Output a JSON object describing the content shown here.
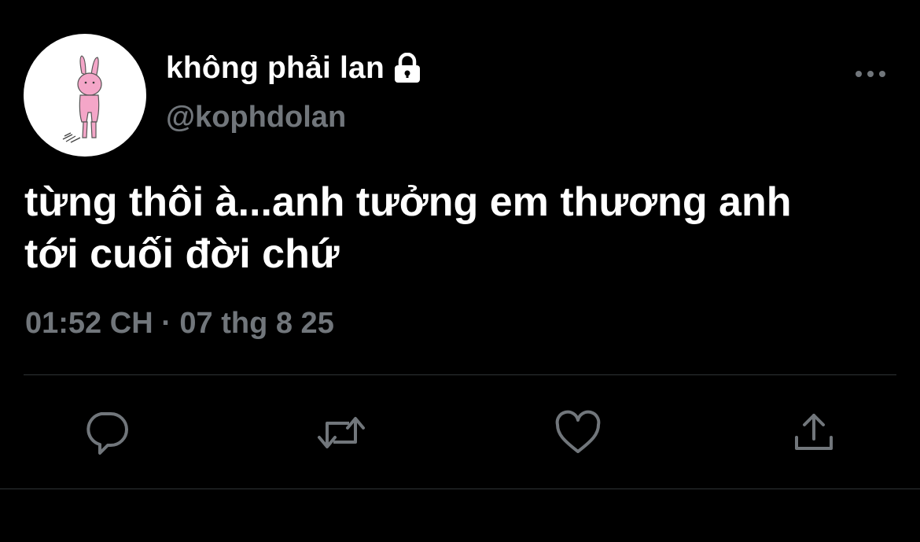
{
  "user": {
    "display_name": "không phải lan",
    "handle": "@kophdolan",
    "protected": true,
    "avatar_icon": "pink-bunny-avatar"
  },
  "tweet": {
    "text_lines": [
      "từng thôi à...anh tưởng em thương anh",
      "tới cuối đời chứ"
    ],
    "timestamp": "01:52 CH · 07 thg 8 25"
  },
  "icons": {
    "lock": "lock-icon",
    "more": "more-options-icon",
    "reply": "reply-icon",
    "retweet": "retweet-icon",
    "like": "heart-icon",
    "share": "share-icon"
  },
  "colors": {
    "background": "#000000",
    "primary_text": "#ffffff",
    "secondary_text": "#71767b",
    "divider": "#2f3336",
    "avatar_bunny": "#f4a6c8"
  }
}
